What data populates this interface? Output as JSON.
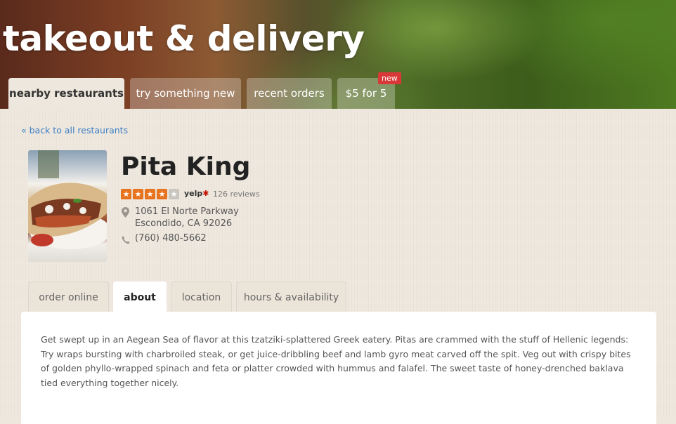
{
  "hero": {
    "title": "takeout & delivery"
  },
  "main_tabs": [
    {
      "label": "nearby restaurants",
      "active": true
    },
    {
      "label": "try something new",
      "active": false
    },
    {
      "label": "recent orders",
      "active": false
    },
    {
      "label": "$5 for 5",
      "active": false,
      "badge": "new"
    }
  ],
  "back_link": "« back to all restaurants",
  "restaurant": {
    "name": "Pita King",
    "rating": 4,
    "rating_max": 5,
    "rating_source": "yelp",
    "reviews": "126 reviews",
    "address_line1": "1061 El Norte Parkway",
    "address_line2": "Escondido, CA 92026",
    "phone": "(760) 480-5662",
    "photo_icon": "gyro-photo"
  },
  "sub_tabs": [
    {
      "label": "order online",
      "active": false
    },
    {
      "label": "about",
      "active": true
    },
    {
      "label": "location",
      "active": false
    },
    {
      "label": "hours & availability",
      "active": false
    }
  ],
  "about_text": "Get swept up in an Aegean Sea of flavor at this tzatziki-splattered Greek eatery. Pitas are crammed with the stuff of Hellenic legends: Try wraps bursting with charbroiled steak, or get juice-dribbling beef and lamb gyro meat carved off the spit. Veg out with crispy bites of golden phyllo-wrapped spinach and feta or platter crowded with hummus and falafel. The sweet taste of honey-drenched baklava tied everything together nicely.",
  "colors": {
    "accent_link": "#3d7fc3",
    "star_on": "#e8731f",
    "star_off": "#c9c6c0",
    "badge": "#d93838"
  }
}
